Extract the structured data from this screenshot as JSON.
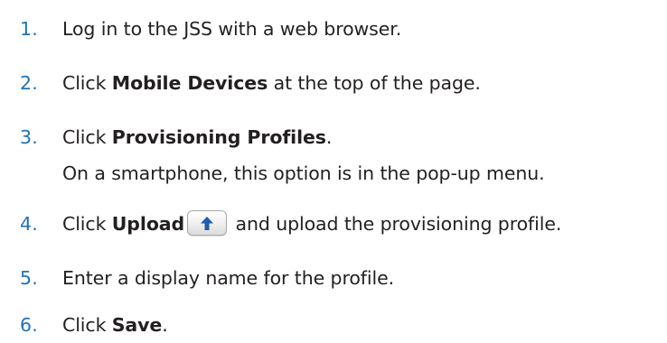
{
  "steps": [
    {
      "number": "1.",
      "text": "Log in to the JSS with a web browser."
    },
    {
      "number": "2.",
      "prefix": "Click ",
      "bold": "Mobile Devices",
      "suffix": " at the top of the page."
    },
    {
      "number": "3.",
      "prefix": "Click ",
      "bold": "Provisioning Profiles",
      "suffix": ".",
      "note": "On a smartphone, this option is in the pop-up menu."
    },
    {
      "number": "4.",
      "prefix": "Click ",
      "bold": "Upload",
      "suffix": " and upload the provisioning profile.",
      "icon": "upload-arrow-icon"
    },
    {
      "number": "5.",
      "text": "Enter a display name for the profile."
    },
    {
      "number": "6.",
      "prefix": "Click ",
      "bold": "Save",
      "suffix": "."
    }
  ],
  "colors": {
    "number": "#1f72b8",
    "text": "#231f20",
    "icon_arrow": "#1f5fa8"
  }
}
